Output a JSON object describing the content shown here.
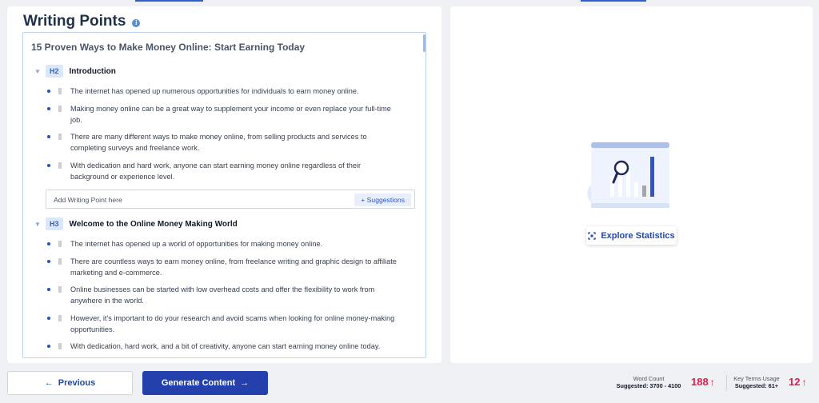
{
  "panel": {
    "title": "Writing Points",
    "info_icon": "info-icon"
  },
  "document": {
    "title": "15 Proven Ways to Make Money Online: Start Earning Today",
    "sections": [
      {
        "level": "H2",
        "heading": "Introduction",
        "points": [
          "The internet has opened up numerous opportunities for individuals to earn money online.",
          "Making money online can be a great way to supplement your income or even replace your full-time job.",
          "There are many different ways to make money online, from selling products and services to completing surveys and freelance work.",
          "With dedication and hard work, anyone can start earning money online regardless of their background or experience level."
        ]
      },
      {
        "level": "H3",
        "heading": "Welcome to the Online Money Making World",
        "points": [
          "The internet has opened up a world of opportunities for making money online.",
          "There are countless ways to earn money online, from freelance writing and graphic design to affiliate marketing and e-commerce.",
          "Online businesses can be started with low overhead costs and offer the flexibility to work from anywhere in the world.",
          "However, it's important to do your research and avoid scams when looking for online money-making opportunities.",
          "With dedication, hard work, and a bit of creativity, anyone can start earning money online today."
        ]
      }
    ],
    "add_point": {
      "placeholder": "Add Writing Point here",
      "suggestions_label": "+ Suggestions"
    }
  },
  "stats_panel": {
    "explore_label": "Explore Statistics",
    "icon": "scan-icon"
  },
  "footer": {
    "previous_label": "Previous",
    "generate_label": "Generate Content",
    "word_count": {
      "label": "Word Count",
      "suggested": "Suggested: 3700 - 4100",
      "value": "188"
    },
    "key_terms": {
      "label": "Key Terms Usage",
      "suggested": "Suggested: 61+",
      "value": "12"
    }
  },
  "colors": {
    "accent": "#2340ad",
    "warning": "#e11d48",
    "badge_bg": "#dbe8fb"
  }
}
